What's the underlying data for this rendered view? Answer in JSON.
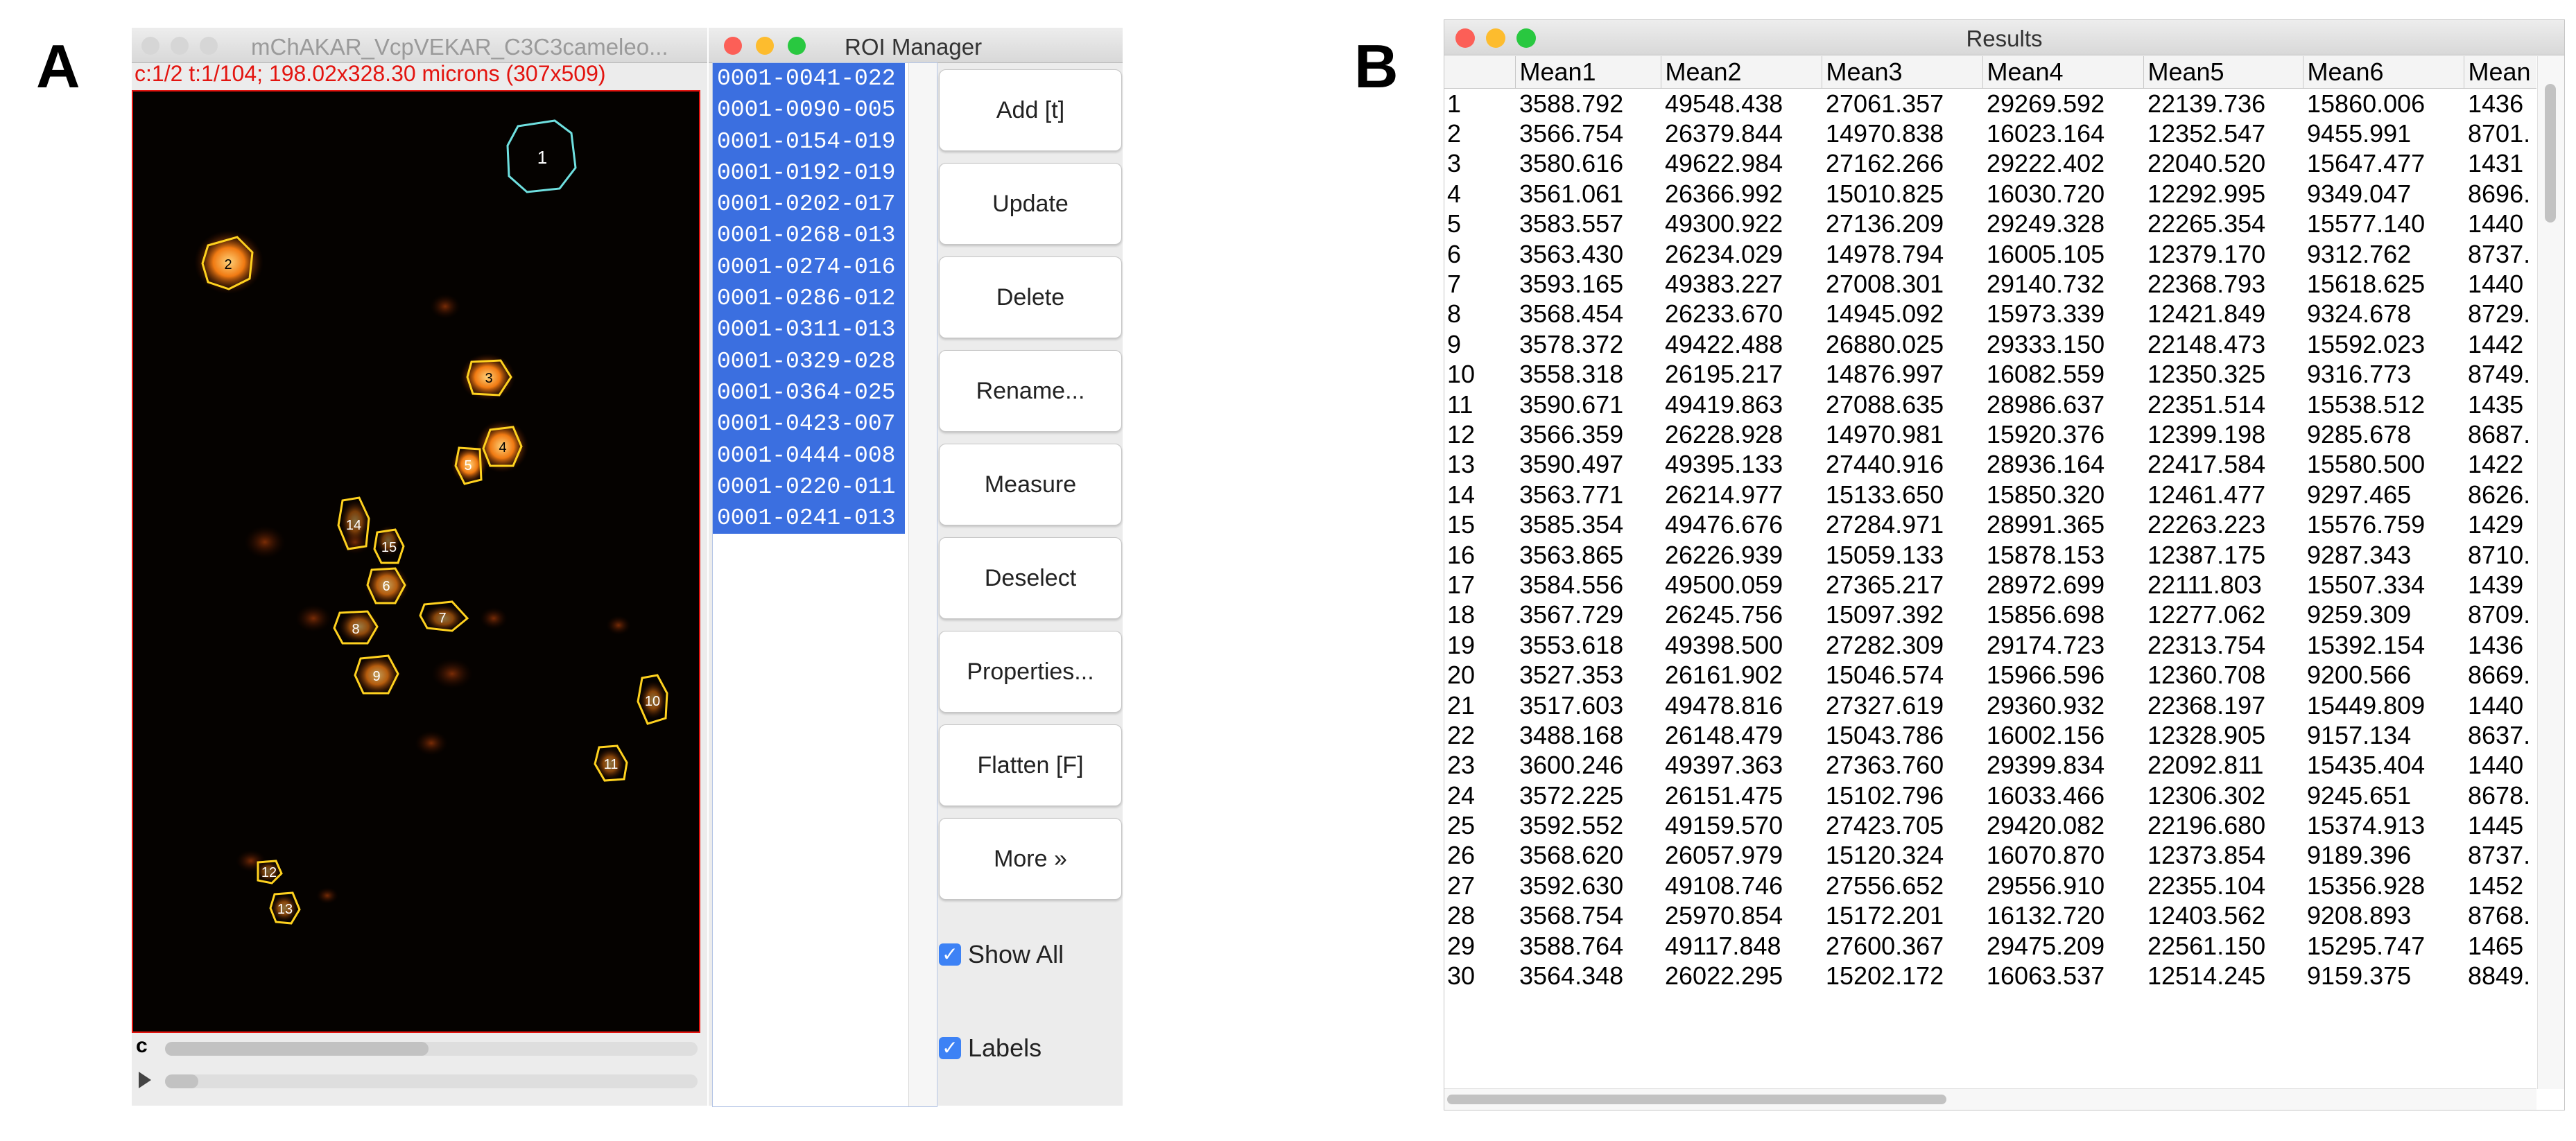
{
  "panels": {
    "a": "A",
    "b": "B"
  },
  "image_window": {
    "title": "mChAKAR_VcpVEKAR_C3C3cameleo...",
    "info": "c:1/2 t:1/104; 198.02x328.30 microns (307x509)",
    "channel_label": "c",
    "roi_labels": [
      "1",
      "2",
      "3",
      "4",
      "5",
      "6",
      "7",
      "8",
      "9",
      "10",
      "11",
      "12",
      "13",
      "14",
      "15"
    ]
  },
  "roi_manager": {
    "title": "ROI Manager",
    "items": [
      "0001-0041-022",
      "0001-0090-005",
      "0001-0154-019",
      "0001-0192-019",
      "0001-0202-017",
      "0001-0268-013",
      "0001-0274-016",
      "0001-0286-012",
      "0001-0311-013",
      "0001-0329-028",
      "0001-0364-025",
      "0001-0423-007",
      "0001-0444-008",
      "0001-0220-011",
      "0001-0241-013"
    ],
    "buttons": [
      "Add [t]",
      "Update",
      "Delete",
      "Rename...",
      "Measure",
      "Deselect",
      "Properties...",
      "Flatten [F]",
      "More »"
    ],
    "show_all": "Show All",
    "labels": "Labels",
    "check_mark": "✓"
  },
  "results": {
    "title": "Results",
    "columns": [
      "",
      "Mean1",
      "Mean2",
      "Mean3",
      "Mean4",
      "Mean5",
      "Mean6",
      "Mean"
    ],
    "rows": [
      [
        "1",
        "3588.792",
        "49548.438",
        "27061.357",
        "29269.592",
        "22139.736",
        "15860.006",
        "1436"
      ],
      [
        "2",
        "3566.754",
        "26379.844",
        "14970.838",
        "16023.164",
        "12352.547",
        "9455.991",
        "8701."
      ],
      [
        "3",
        "3580.616",
        "49622.984",
        "27162.266",
        "29222.402",
        "22040.520",
        "15647.477",
        "1431"
      ],
      [
        "4",
        "3561.061",
        "26366.992",
        "15010.825",
        "16030.720",
        "12292.995",
        "9349.047",
        "8696."
      ],
      [
        "5",
        "3583.557",
        "49300.922",
        "27136.209",
        "29249.328",
        "22265.354",
        "15577.140",
        "1440"
      ],
      [
        "6",
        "3563.430",
        "26234.029",
        "14978.794",
        "16005.105",
        "12379.170",
        "9312.762",
        "8737."
      ],
      [
        "7",
        "3593.165",
        "49383.227",
        "27008.301",
        "29140.732",
        "22368.793",
        "15618.625",
        "1440"
      ],
      [
        "8",
        "3568.454",
        "26233.670",
        "14945.092",
        "15973.339",
        "12421.849",
        "9324.678",
        "8729."
      ],
      [
        "9",
        "3578.372",
        "49422.488",
        "26880.025",
        "29333.150",
        "22148.473",
        "15592.023",
        "1442"
      ],
      [
        "10",
        "3558.318",
        "26195.217",
        "14876.997",
        "16082.559",
        "12350.325",
        "9316.773",
        "8749."
      ],
      [
        "11",
        "3590.671",
        "49419.863",
        "27088.635",
        "28986.637",
        "22351.514",
        "15538.512",
        "1435"
      ],
      [
        "12",
        "3566.359",
        "26228.928",
        "14970.981",
        "15920.376",
        "12399.198",
        "9285.678",
        "8687."
      ],
      [
        "13",
        "3590.497",
        "49395.133",
        "27440.916",
        "28936.164",
        "22417.584",
        "15580.500",
        "1422"
      ],
      [
        "14",
        "3563.771",
        "26214.977",
        "15133.650",
        "15850.320",
        "12461.477",
        "9297.465",
        "8626."
      ],
      [
        "15",
        "3585.354",
        "49476.676",
        "27284.971",
        "28991.365",
        "22263.223",
        "15576.759",
        "1429"
      ],
      [
        "16",
        "3563.865",
        "26226.939",
        "15059.133",
        "15878.153",
        "12387.175",
        "9287.343",
        "8710."
      ],
      [
        "17",
        "3584.556",
        "49500.059",
        "27365.217",
        "28972.699",
        "22111.803",
        "15507.334",
        "1439"
      ],
      [
        "18",
        "3567.729",
        "26245.756",
        "15097.392",
        "15856.698",
        "12277.062",
        "9259.309",
        "8709."
      ],
      [
        "19",
        "3553.618",
        "49398.500",
        "27282.309",
        "29174.723",
        "22313.754",
        "15392.154",
        "1436"
      ],
      [
        "20",
        "3527.353",
        "26161.902",
        "15046.574",
        "15966.596",
        "12360.708",
        "9200.566",
        "8669."
      ],
      [
        "21",
        "3517.603",
        "49478.816",
        "27327.619",
        "29360.932",
        "22368.197",
        "15449.809",
        "1440"
      ],
      [
        "22",
        "3488.168",
        "26148.479",
        "15043.786",
        "16002.156",
        "12328.905",
        "9157.134",
        "8637."
      ],
      [
        "23",
        "3600.246",
        "49397.363",
        "27363.760",
        "29399.834",
        "22092.811",
        "15435.404",
        "1440"
      ],
      [
        "24",
        "3572.225",
        "26151.475",
        "15102.796",
        "16033.466",
        "12306.302",
        "9245.651",
        "8678."
      ],
      [
        "25",
        "3592.552",
        "49159.570",
        "27423.705",
        "29420.082",
        "22196.680",
        "15374.913",
        "1445"
      ],
      [
        "26",
        "3568.620",
        "26057.979",
        "15120.324",
        "16070.870",
        "12373.854",
        "9189.396",
        "8737."
      ],
      [
        "27",
        "3592.630",
        "49108.746",
        "27556.652",
        "29556.910",
        "22355.104",
        "15356.928",
        "1452"
      ],
      [
        "28",
        "3568.754",
        "25970.854",
        "15172.201",
        "16132.720",
        "12403.562",
        "9208.893",
        "8768."
      ],
      [
        "29",
        "3588.764",
        "49117.848",
        "27600.367",
        "29475.209",
        "22561.150",
        "15295.747",
        "1465"
      ],
      [
        "30",
        "3564.348",
        "26022.295",
        "15202.172",
        "16063.537",
        "12514.245",
        "9159.375",
        "8849."
      ]
    ]
  },
  "colors": {
    "selection_blue": "#3b6fe0",
    "roi_yellow": "#ffd21f",
    "roi_cyan": "#6fe0e0",
    "info_red": "#e3140f",
    "close_red": "#fc5f57",
    "min_yellow": "#fdbc2e",
    "max_green": "#29c840"
  },
  "icons": [
    "close-icon",
    "minimize-icon",
    "zoom-icon",
    "checkbox-checked-icon",
    "play-icon"
  ]
}
